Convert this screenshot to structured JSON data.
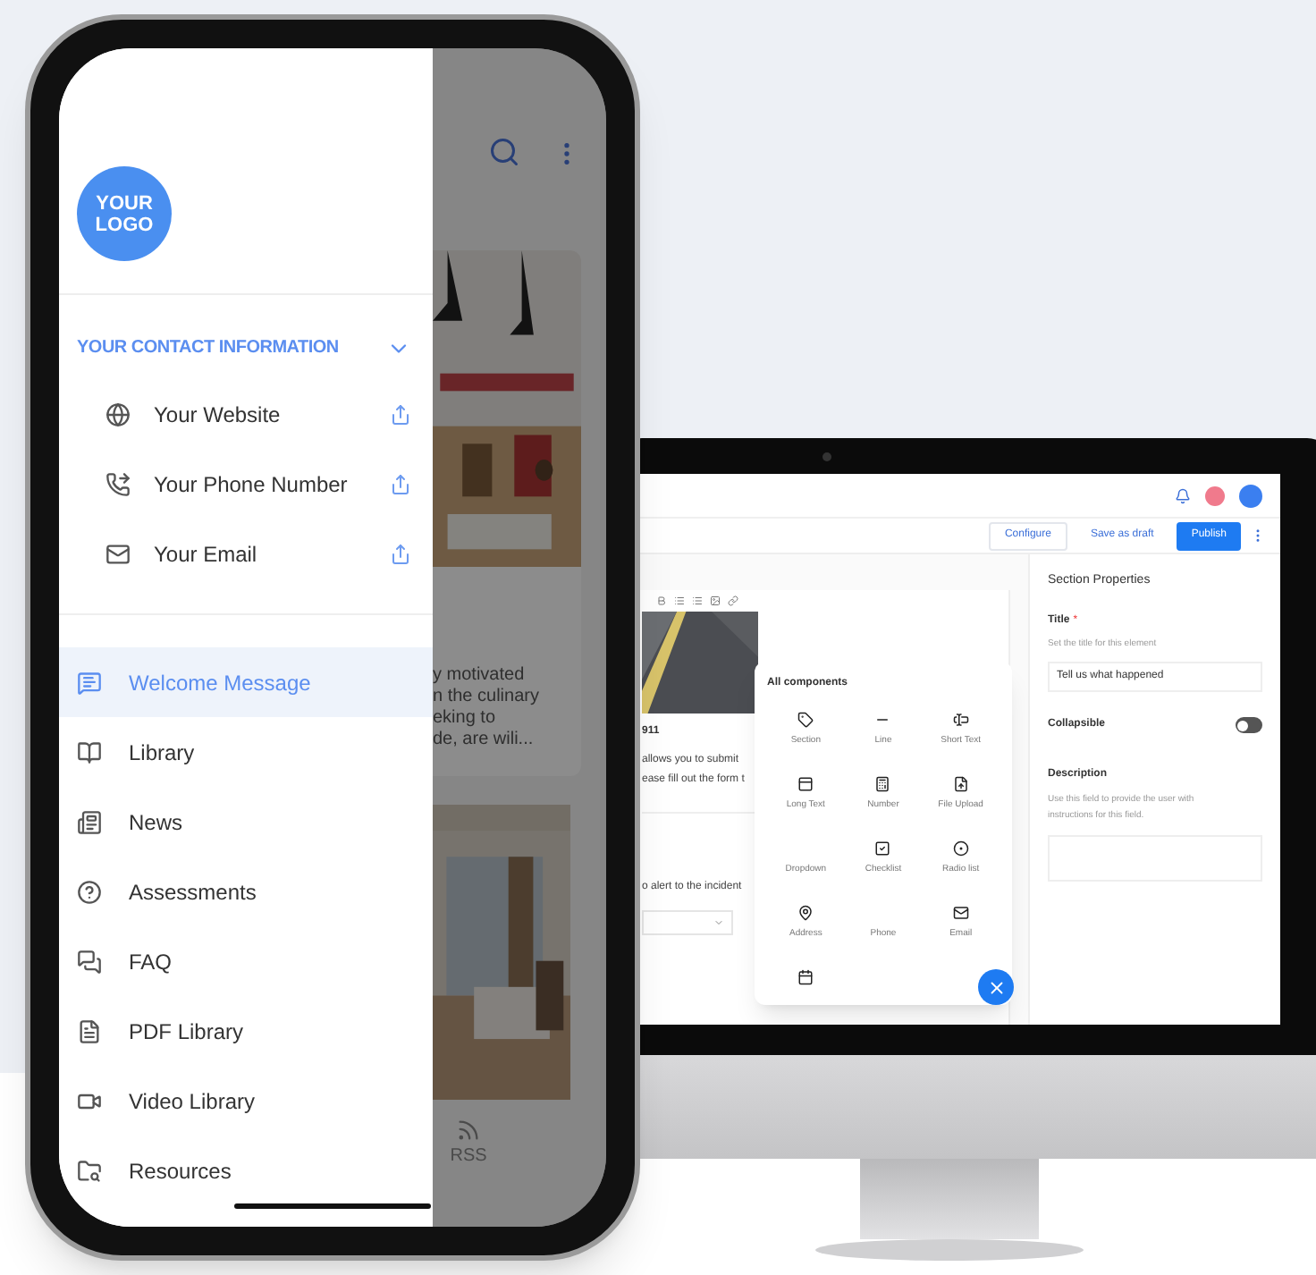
{
  "phone": {
    "logo_lines": [
      "YOUR",
      "LOGO"
    ],
    "contact": {
      "heading": "YOUR CONTACT INFORMATION",
      "expanded": true,
      "items": [
        {
          "label": "Your Website"
        },
        {
          "label": "Your Phone Number"
        },
        {
          "label": "Your Email"
        }
      ]
    },
    "menu": [
      {
        "label": "Welcome Message",
        "selected": true
      },
      {
        "label": "Library",
        "selected": false
      },
      {
        "label": "News",
        "selected": false
      },
      {
        "label": "Assessments",
        "selected": false
      },
      {
        "label": "FAQ",
        "selected": false
      },
      {
        "label": "PDF Library",
        "selected": false
      },
      {
        "label": "Video Library",
        "selected": false
      },
      {
        "label": "Resources",
        "selected": false
      }
    ],
    "behind": {
      "card_lines": [
        "y motivated",
        "n the culinary",
        "eking to",
        "de, are wili..."
      ],
      "tab_label": "RSS"
    }
  },
  "monitor": {
    "header_buttons": [
      {
        "label": "Configure",
        "kind": "outline"
      },
      {
        "label": "Save as draft",
        "kind": "plain"
      },
      {
        "label": "Publish",
        "kind": "primary"
      }
    ],
    "form": {
      "title": "911",
      "description_lines": [
        "allows you to submit",
        "ease fill out the form t"
      ],
      "question": "o alert to the incident"
    },
    "components": {
      "heading": "All components",
      "items": [
        "Section",
        "Line",
        "Short Text",
        "Long Text",
        "Number",
        "File Upload",
        "Dropdown",
        "Checklist",
        "Radio list",
        "Address",
        "Phone",
        "Email"
      ]
    },
    "properties": {
      "heading": "Section Properties",
      "title_label": "Title",
      "required_mark": "*",
      "title_hint": "Set the title for this element",
      "title_value": "Tell us what happened",
      "collapsible_label": "Collapsible",
      "collapsible_on": false,
      "description_label": "Description",
      "description_hint": "Use this field to provide the user with instructions for this field."
    }
  }
}
